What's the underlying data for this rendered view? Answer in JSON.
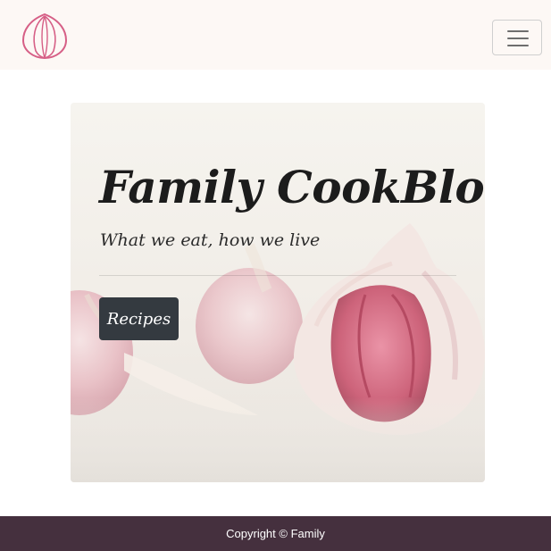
{
  "navbar": {
    "logo_icon": "garlic-outline-icon",
    "toggler_icon": "hamburger-menu-icon",
    "colors": {
      "background": "#fdf8f5",
      "logo": "#d65f86"
    }
  },
  "hero": {
    "title": "Family CookBlog",
    "subtitle": "What we eat, how we live",
    "button_label": "Recipes",
    "background_image": "garlic-bulbs-photo",
    "colors": {
      "button": "#343a40"
    }
  },
  "footer": {
    "text": "Copyright © Family",
    "colors": {
      "background": "#45303e"
    }
  }
}
